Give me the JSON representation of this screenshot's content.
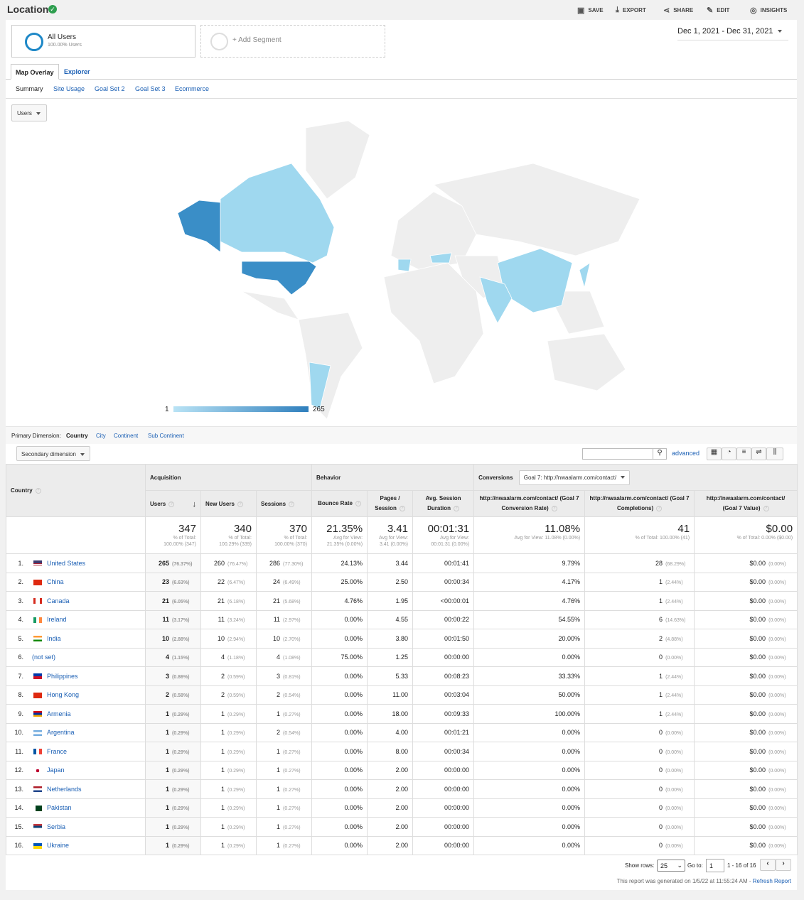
{
  "header": {
    "title": "Location",
    "actions": [
      {
        "icon": "save-icon",
        "label": "SAVE"
      },
      {
        "icon": "export-icon",
        "label": "EXPORT"
      },
      {
        "icon": "share-icon",
        "label": "SHARE"
      },
      {
        "icon": "edit-icon",
        "label": "EDIT"
      },
      {
        "icon": "insights-icon",
        "label": "INSIGHTS"
      }
    ]
  },
  "segments": {
    "name": "All Users",
    "sub": "100.00% Users",
    "add": "+ Add Segment"
  },
  "date_range": "Dec 1, 2021 - Dec 31, 2021",
  "tabs": [
    "Map Overlay",
    "Explorer"
  ],
  "subtabs": [
    "Summary",
    "Site Usage",
    "Goal Set 2",
    "Goal Set 3",
    "Ecommerce"
  ],
  "metric_select": "Users",
  "map": {
    "legend_min": "1",
    "legend_max": "265",
    "colors": {
      "high": "#3a8ec7",
      "mid": "#9fd8ef",
      "none": "#eeeeee"
    }
  },
  "primary_dimension": {
    "label": "Primary Dimension:",
    "options": [
      "Country",
      "City",
      "Continent",
      "Sub Continent"
    ]
  },
  "secondary_dimension": "Secondary dimension",
  "advanced": "advanced",
  "table": {
    "country_header": "Country",
    "groups": {
      "acq": "Acquisition",
      "beh": "Behavior",
      "conv": "Conversions",
      "goal_select": "Goal 7: http://nwaalarm.com/contact/"
    },
    "columns": [
      "Users",
      "New Users",
      "Sessions",
      "Bounce Rate",
      "Pages / Session",
      "Avg. Session Duration",
      "http://nwaalarm.com/contact/ (Goal 7 Conversion Rate)",
      "http://nwaalarm.com/contact/ (Goal 7 Completions)",
      "http://nwaalarm.com/contact/ (Goal 7 Value)"
    ],
    "totals": [
      [
        "347",
        "% of Total:",
        "100.00% (347)"
      ],
      [
        "340",
        "% of Total:",
        "100.29% (339)"
      ],
      [
        "370",
        "% of Total:",
        "100.00% (370)"
      ],
      [
        "21.35%",
        "Avg for View:",
        "21.35% (0.00%)"
      ],
      [
        "3.41",
        "Avg for View:",
        "3.41 (0.00%)"
      ],
      [
        "00:01:31",
        "Avg for View:",
        "00:01:31 (0.00%)"
      ],
      [
        "11.08%",
        "Avg for View: 11.08% (0.00%)",
        ""
      ],
      [
        "41",
        "% of Total: 100.00% (41)",
        ""
      ],
      [
        "$0.00",
        "% of Total: 0.00% ($0.00)",
        ""
      ]
    ],
    "rows": [
      [
        "1.",
        "United States",
        "us",
        "265",
        "(76.37%)",
        "260",
        "(76.47%)",
        "286",
        "(77.30%)",
        "24.13%",
        "3.44",
        "00:01:41",
        "9.79%",
        "28",
        "(68.29%)",
        "$0.00",
        "(0.00%)"
      ],
      [
        "2.",
        "China",
        "cn",
        "23",
        "(6.63%)",
        "22",
        "(6.47%)",
        "24",
        "(6.49%)",
        "25.00%",
        "2.50",
        "00:00:34",
        "4.17%",
        "1",
        "(2.44%)",
        "$0.00",
        "(0.00%)"
      ],
      [
        "3.",
        "Canada",
        "ca",
        "21",
        "(6.05%)",
        "21",
        "(6.18%)",
        "21",
        "(5.68%)",
        "4.76%",
        "1.95",
        "<00:00:01",
        "4.76%",
        "1",
        "(2.44%)",
        "$0.00",
        "(0.00%)"
      ],
      [
        "4.",
        "Ireland",
        "ie",
        "11",
        "(3.17%)",
        "11",
        "(3.24%)",
        "11",
        "(2.97%)",
        "0.00%",
        "4.55",
        "00:00:22",
        "54.55%",
        "6",
        "(14.63%)",
        "$0.00",
        "(0.00%)"
      ],
      [
        "5.",
        "India",
        "in",
        "10",
        "(2.88%)",
        "10",
        "(2.94%)",
        "10",
        "(2.70%)",
        "0.00%",
        "3.80",
        "00:01:50",
        "20.00%",
        "2",
        "(4.88%)",
        "$0.00",
        "(0.00%)"
      ],
      [
        "6.",
        "(not set)",
        "",
        "4",
        "(1.15%)",
        "4",
        "(1.18%)",
        "4",
        "(1.08%)",
        "75.00%",
        "1.25",
        "00:00:00",
        "0.00%",
        "0",
        "(0.00%)",
        "$0.00",
        "(0.00%)"
      ],
      [
        "7.",
        "Philippines",
        "ph",
        "3",
        "(0.86%)",
        "2",
        "(0.59%)",
        "3",
        "(0.81%)",
        "0.00%",
        "5.33",
        "00:08:23",
        "33.33%",
        "1",
        "(2.44%)",
        "$0.00",
        "(0.00%)"
      ],
      [
        "8.",
        "Hong Kong",
        "hk",
        "2",
        "(0.58%)",
        "2",
        "(0.59%)",
        "2",
        "(0.54%)",
        "0.00%",
        "11.00",
        "00:03:04",
        "50.00%",
        "1",
        "(2.44%)",
        "$0.00",
        "(0.00%)"
      ],
      [
        "9.",
        "Armenia",
        "am",
        "1",
        "(0.29%)",
        "1",
        "(0.29%)",
        "1",
        "(0.27%)",
        "0.00%",
        "18.00",
        "00:09:33",
        "100.00%",
        "1",
        "(2.44%)",
        "$0.00",
        "(0.00%)"
      ],
      [
        "10.",
        "Argentina",
        "ar",
        "1",
        "(0.29%)",
        "1",
        "(0.29%)",
        "2",
        "(0.54%)",
        "0.00%",
        "4.00",
        "00:01:21",
        "0.00%",
        "0",
        "(0.00%)",
        "$0.00",
        "(0.00%)"
      ],
      [
        "11.",
        "France",
        "fr",
        "1",
        "(0.29%)",
        "1",
        "(0.29%)",
        "1",
        "(0.27%)",
        "0.00%",
        "8.00",
        "00:00:34",
        "0.00%",
        "0",
        "(0.00%)",
        "$0.00",
        "(0.00%)"
      ],
      [
        "12.",
        "Japan",
        "jp",
        "1",
        "(0.29%)",
        "1",
        "(0.29%)",
        "1",
        "(0.27%)",
        "0.00%",
        "2.00",
        "00:00:00",
        "0.00%",
        "0",
        "(0.00%)",
        "$0.00",
        "(0.00%)"
      ],
      [
        "13.",
        "Netherlands",
        "nl",
        "1",
        "(0.29%)",
        "1",
        "(0.29%)",
        "1",
        "(0.27%)",
        "0.00%",
        "2.00",
        "00:00:00",
        "0.00%",
        "0",
        "(0.00%)",
        "$0.00",
        "(0.00%)"
      ],
      [
        "14.",
        "Pakistan",
        "pk",
        "1",
        "(0.29%)",
        "1",
        "(0.29%)",
        "1",
        "(0.27%)",
        "0.00%",
        "2.00",
        "00:00:00",
        "0.00%",
        "0",
        "(0.00%)",
        "$0.00",
        "(0.00%)"
      ],
      [
        "15.",
        "Serbia",
        "rs",
        "1",
        "(0.29%)",
        "1",
        "(0.29%)",
        "1",
        "(0.27%)",
        "0.00%",
        "2.00",
        "00:00:00",
        "0.00%",
        "0",
        "(0.00%)",
        "$0.00",
        "(0.00%)"
      ],
      [
        "16.",
        "Ukraine",
        "ua",
        "1",
        "(0.29%)",
        "1",
        "(0.29%)",
        "1",
        "(0.27%)",
        "0.00%",
        "2.00",
        "00:00:00",
        "0.00%",
        "0",
        "(0.00%)",
        "$0.00",
        "(0.00%)"
      ]
    ]
  },
  "pagination": {
    "show_rows": "Show rows:",
    "rows_value": "25",
    "goto": "Go to:",
    "goto_value": "1",
    "range": "1 - 16 of 16"
  },
  "footer": {
    "generated": "This report was generated on 1/5/22 at 11:55:24 AM - ",
    "refresh": "Refresh Report"
  }
}
